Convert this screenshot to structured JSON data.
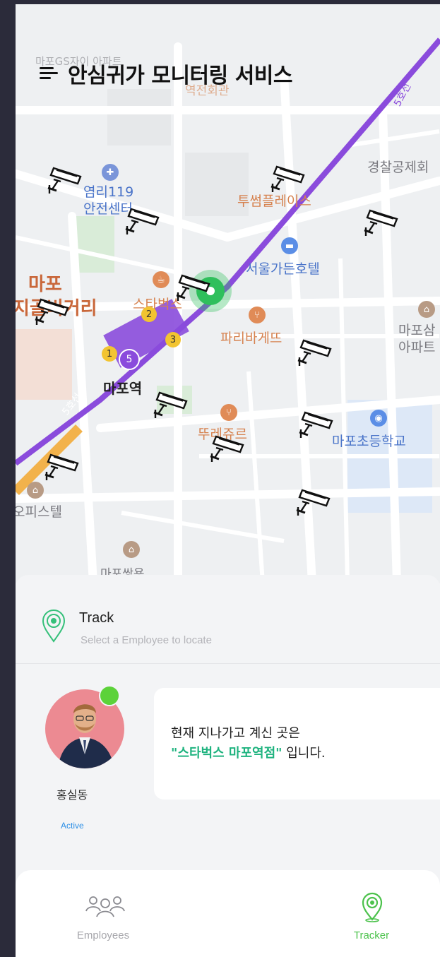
{
  "header": {
    "title": "안심귀가 모니터링 서비스"
  },
  "map": {
    "labels": {
      "apt1": "마포GS자이\n아파트",
      "hall": "역전회관",
      "fire": "염리119\n안전센터",
      "tusum": "투썸플레이스",
      "police": "경찰공제회",
      "hotel": "서울가든호텔",
      "mapo_a": "마포",
      "mapo_b": "지골비거리",
      "starbucks": "스타벅스",
      "paris": "파리바게뜨",
      "apt2": "마포삼\n아파트",
      "station": "마포역",
      "line5a": "5호선",
      "line5b": "5호선",
      "ttu": "뚜레쥬르",
      "school": "마포초등학교",
      "office": "오피스텔",
      "ssangyong": "마포쌍용"
    },
    "exits": [
      "1",
      "2",
      "3",
      "5"
    ]
  },
  "track": {
    "title": "Track",
    "subtitle": "Select a Employee to locate"
  },
  "employee": {
    "name": "홍실동",
    "status": "Active"
  },
  "message": {
    "line1": "현재 지나가고 계신 곳은",
    "place": "\"스타벅스 마포역점\"",
    "suffix": " 입니다."
  },
  "nav": {
    "employees": "Employees",
    "tracker": "Tracker"
  },
  "colors": {
    "accent": "#2fbf5c",
    "line5": "#8a4bdc",
    "status": "#2c8fe6"
  }
}
